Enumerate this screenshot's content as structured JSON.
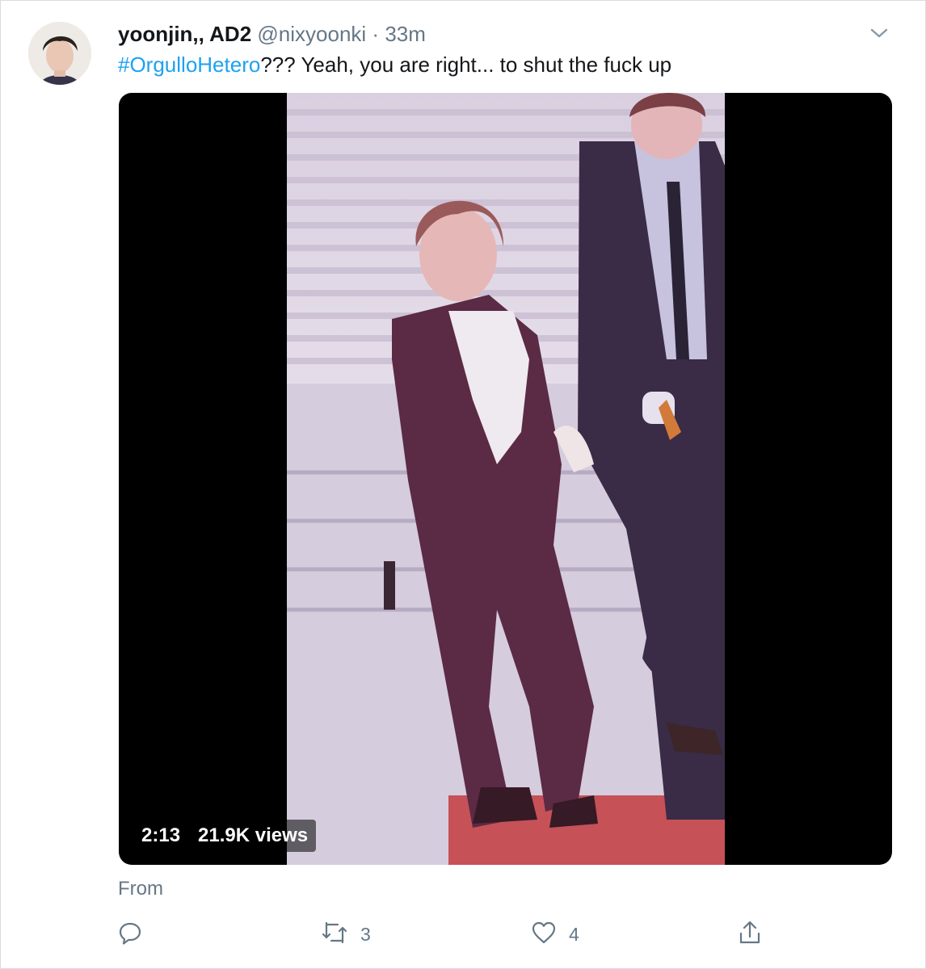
{
  "tweet": {
    "display_name": "yoonjin,, AD2",
    "handle": "@nixyoonki",
    "separator": "·",
    "time": "33m",
    "hashtag": "#OrgulloHetero",
    "text_rest": "??? Yeah, you are right... to shut the fuck up"
  },
  "media": {
    "duration": "2:13",
    "views": "21.9K views"
  },
  "attribution": {
    "from_label": "From"
  },
  "actions": {
    "reply_count": "",
    "retweet_count": "3",
    "like_count": "4"
  },
  "icons": {
    "menu": "chevron-down-icon",
    "reply": "reply-icon",
    "retweet": "retweet-icon",
    "like": "heart-icon",
    "share": "share-icon"
  },
  "colors": {
    "link": "#1da1f2",
    "secondary_text": "#657786",
    "primary_text": "#14171a",
    "media_background": "#000000"
  }
}
